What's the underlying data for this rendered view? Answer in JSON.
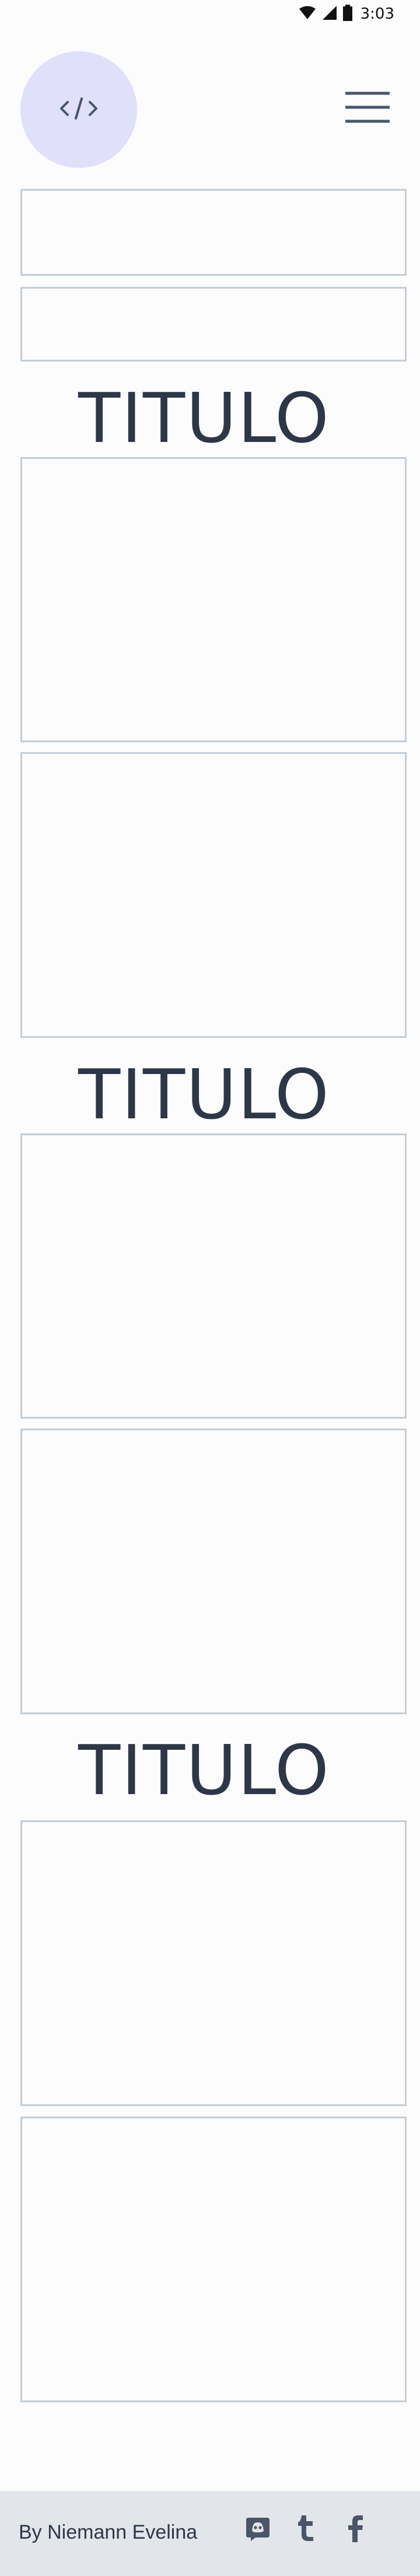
{
  "status_bar": {
    "time": "3:03",
    "icons": [
      "wifi-icon",
      "signal-icon",
      "battery-icon"
    ]
  },
  "header": {
    "logo_icon": "code-icon",
    "menu_icon": "hamburger-menu-icon"
  },
  "sections": [
    {
      "title": "TITULO"
    },
    {
      "title": "TITULO"
    },
    {
      "title": "TITULO"
    }
  ],
  "footer": {
    "author": "By Niemann Evelina",
    "social_icons": [
      "discord-icon",
      "tumblr-icon",
      "facebook-icon"
    ]
  },
  "colors": {
    "logo_background": "#e0e0fb",
    "box_border": "#c3cdd6",
    "text": "#2d3748",
    "footer_background": "#e2e6ea",
    "icon": "#4a5568"
  }
}
